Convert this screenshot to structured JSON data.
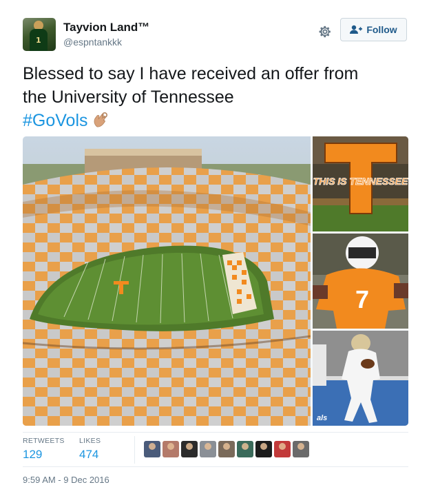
{
  "user": {
    "name": "Tayvion Land™",
    "handle": "@espntankkk",
    "avatar_number": "1"
  },
  "follow_button": {
    "label": "Follow"
  },
  "tweet": {
    "line1": "Blessed to say I have received an offer from",
    "line2": "the University of Tennessee",
    "hashtag": "#GoVols",
    "emoji": "ok-hand-emoji"
  },
  "media": {
    "banner_text": "THIS IS TENNESSEE",
    "jersey_number": "7",
    "watermark": "als"
  },
  "stats": {
    "retweets_label": "RETWEETS",
    "retweets_value": "129",
    "likes_label": "LIKES",
    "likes_value": "474"
  },
  "likers": [
    {
      "color": "#4a5b7a"
    },
    {
      "color": "#b47a6a"
    },
    {
      "color": "#2b2b2b"
    },
    {
      "color": "#8a8f96"
    },
    {
      "color": "#7a6a5a"
    },
    {
      "color": "#3a6a5a"
    },
    {
      "color": "#1c1c1c"
    },
    {
      "color": "#c23a3a"
    },
    {
      "color": "#6a6a6a"
    }
  ],
  "timestamp": "9:59 AM - 9 Dec 2016",
  "colors": {
    "link": "#1b95e0",
    "tennessee_orange": "#f28a1e",
    "muted": "#657786"
  }
}
